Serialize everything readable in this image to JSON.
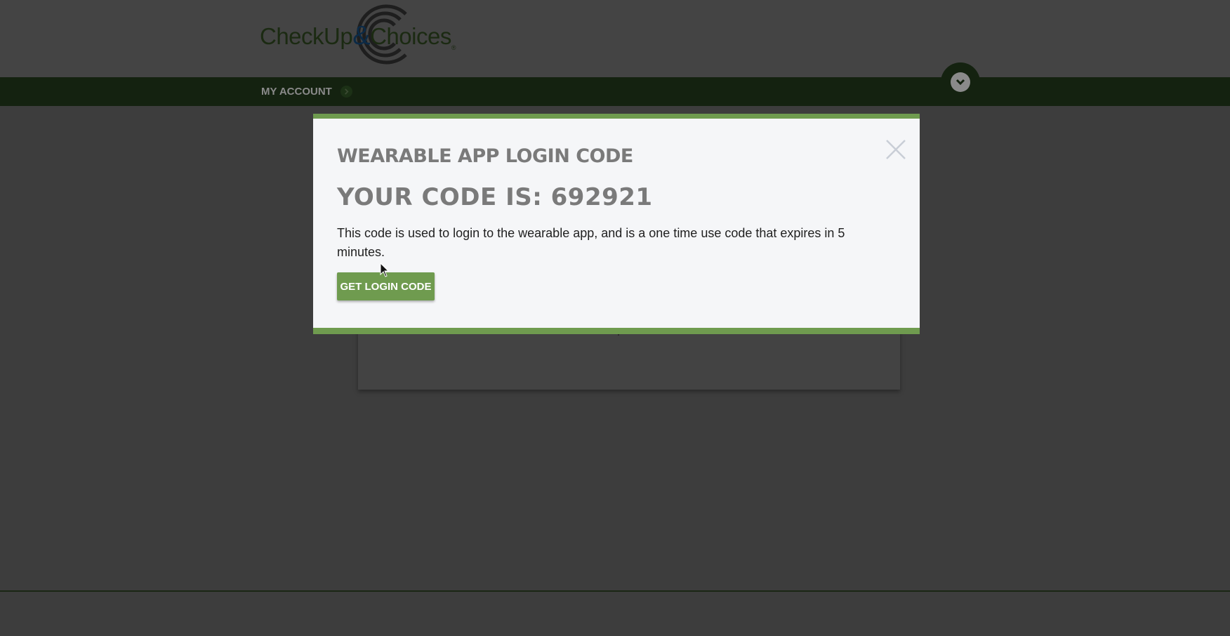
{
  "header": {
    "logo": {
      "text_left": "CheckUp",
      "ampersand": "&",
      "text_right": "Choices",
      "registered": "®"
    }
  },
  "nav": {
    "my_account_label": "MY ACCOUNT",
    "arrow_icon": "chevron-right-icon",
    "toggle_icon": "chevron-down-icon"
  },
  "modal": {
    "title": "WEARABLE APP LOGIN CODE",
    "code_line": "YOUR CODE IS: 692921",
    "description": "This code is used to login to the wearable app, and is a one time use code that expires in 5 minutes.",
    "button_label": "GET LOGIN CODE",
    "close_icon": "close-icon"
  },
  "colors": {
    "brand_green": "#6f9b4f",
    "nav_dark_green": "#142210",
    "overlay_gray": "#3d3d3d"
  }
}
